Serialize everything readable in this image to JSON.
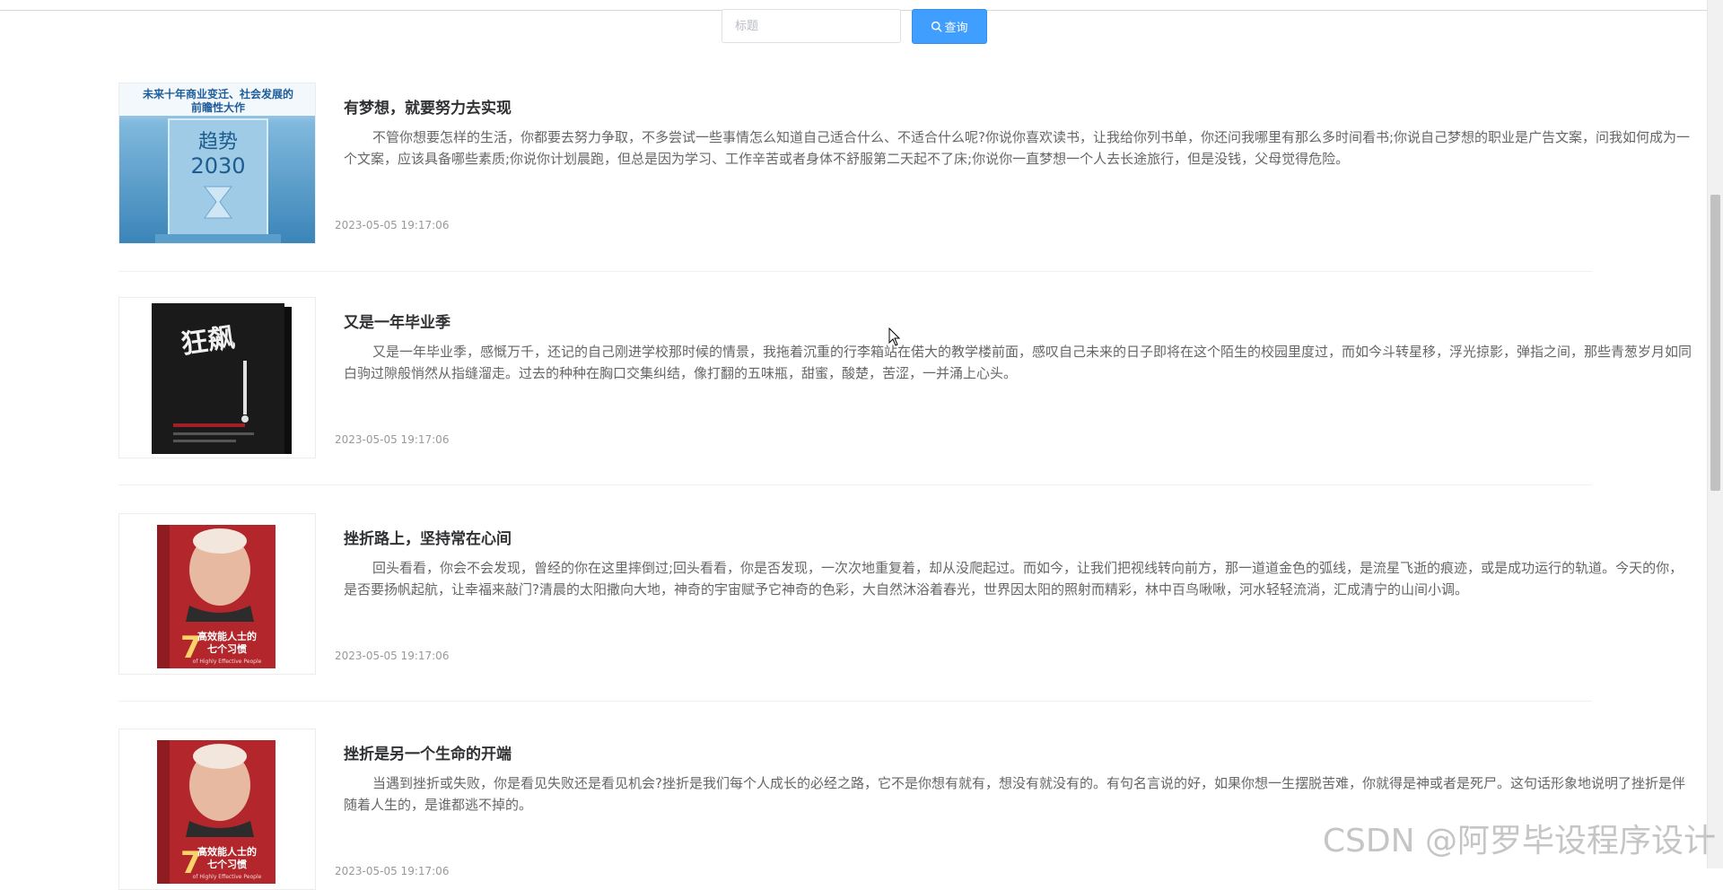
{
  "search": {
    "placeholder": "标题",
    "button_label": "查询",
    "button_icon": "search-icon"
  },
  "articles": [
    {
      "title": "有梦想，就要努力去实现",
      "summary": "不管你想要怎样的生活，你都要去努力争取，不多尝试一些事情怎么知道自己适合什么、不适合什么呢?你说你喜欢读书，让我给你列书单，你还问我哪里有那么多时间看书;你说自己梦想的职业是广告文案，问我如何成为一个文案，应该具备哪些素质;你说你计划晨跑，但总是因为学习、工作辛苦或者身体不舒服第二天起不了床;你说你一直梦想一个人去长途旅行，但是没钱，父母觉得危险。",
      "time": "2023-05-05 19:17:06",
      "cover": {
        "banner": "未来十年商业变迁、社会发展的前瞻性大作",
        "title": "趋势2030",
        "bg": "#4a94c4"
      }
    },
    {
      "title": "又是一年毕业季",
      "summary": "又是一年毕业季，感慨万千，还记的自己刚进学校那时候的情景，我拖着沉重的行李箱站在偌大的教学楼前面，感叹自己未来的日子即将在这个陌生的校园里度过，而如今斗转星移，浮光掠影，弹指之间，那些青葱岁月如同白驹过隙般悄然从指缝溜走。过去的种种在胸口交集纠结，像打翻的五味瓶，甜蜜，酸楚，苦涩，一并涌上心头。",
      "time": "2023-05-05 19:17:06",
      "cover": {
        "title": "狂飙",
        "bg": "#1c1c1c"
      }
    },
    {
      "title": "挫折路上，坚持常在心间",
      "summary": "回头看看，你会不会发现，曾经的你在这里摔倒过;回头看看，你是否发现，一次次地重复着，却从没爬起过。而如今，让我们把视线转向前方，那一道道金色的弧线，是流星飞逝的痕迹，或是成功运行的轨道。今天的你，是否要扬帆起航，让幸福来敲门?清晨的太阳撒向大地，神奇的宇宙赋予它神奇的色彩，大自然沐浴着春光，世界因太阳的照射而精彩，林中百鸟啾啾，河水轻轻流淌，汇成清宁的山间小调。",
      "time": "2023-05-05 19:17:06",
      "cover": {
        "number": "7",
        "title": "高效能人士的七个习惯",
        "subtitle": "of Highly Effective People",
        "bg": "#b3262b"
      }
    },
    {
      "title": "挫折是另一个生命的开端",
      "summary": "当遇到挫折或失败，你是看见失败还是看见机会?挫折是我们每个人成长的必经之路，它不是你想有就有，想没有就没有的。有句名言说的好，如果你想一生摆脱苦难，你就得是神或者是死尸。这句话形象地说明了挫折是伴随着人生的，是谁都逃不掉的。",
      "time": "2023-05-05 19:17:06",
      "cover": {
        "number": "7",
        "title": "高效能人士的七个习惯",
        "subtitle": "of Highly Effective People",
        "bg": "#b3262b"
      }
    }
  ],
  "watermark": "CSDN @阿罗毕设程序设计"
}
